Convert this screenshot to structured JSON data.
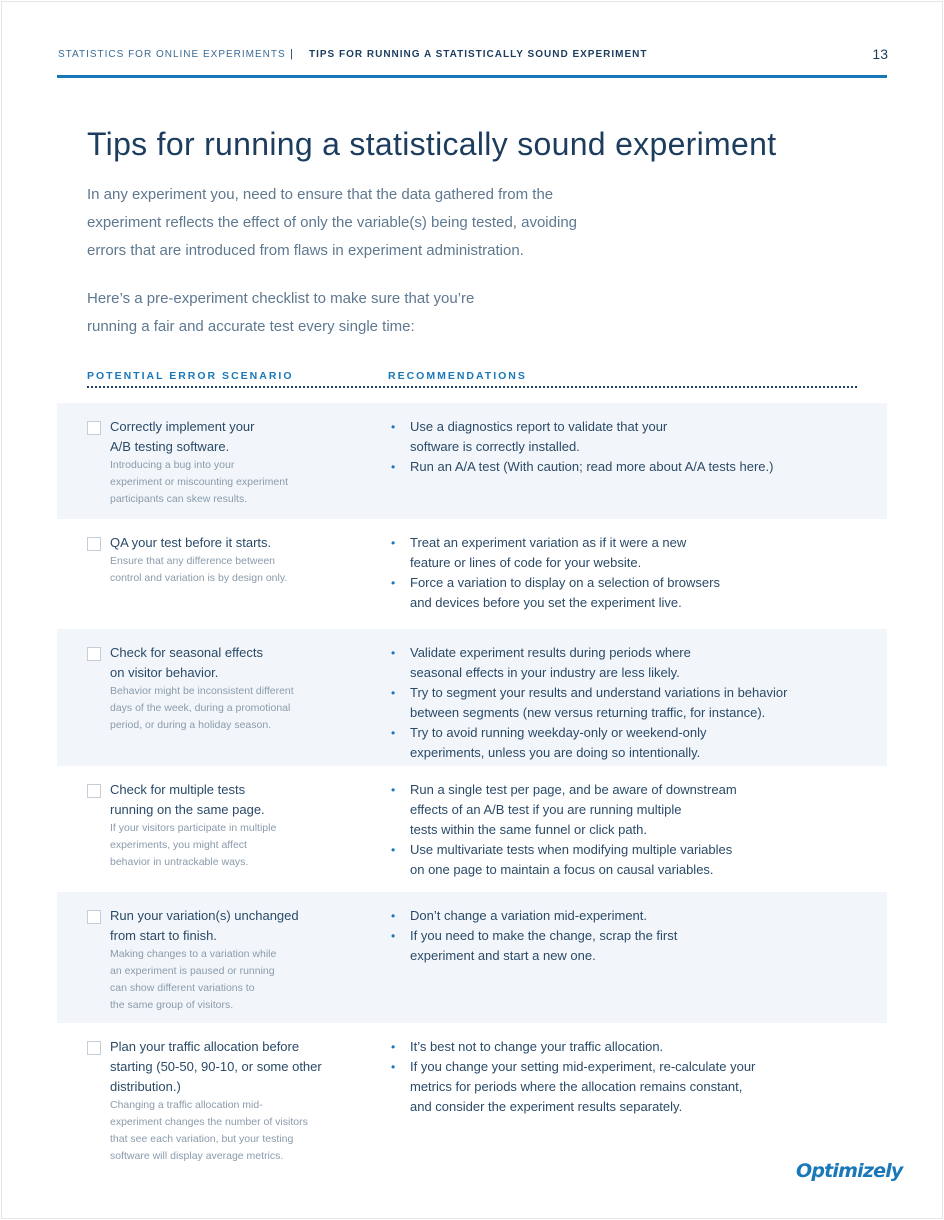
{
  "header": {
    "running_title": "STATISTICS FOR ONLINE EXPERIMENTS",
    "separator": "|",
    "section_title": "TIPS FOR RUNNING A STATISTICALLY SOUND EXPERIMENT",
    "page_number": "13"
  },
  "main": {
    "title": "Tips for running a statistically sound experiment",
    "intro_lines": [
      "In any experiment you, need to ensure that the data gathered from the",
      "experiment reflects the effect of only the variable(s) being tested, avoiding",
      "errors that are introduced from flaws in experiment administration."
    ],
    "checklist_intro_lines": [
      "Here’s a pre-experiment checklist to make sure that you’re",
      "running a fair and accurate test every single time:"
    ],
    "col_scenario": "POTENTIAL ERROR SCENARIO",
    "col_recommendations": "RECOMMENDATIONS"
  },
  "rows": [
    {
      "scenario_lines": [
        "Correctly implement your",
        "A/B testing software."
      ],
      "desc_lines": [
        "Introducing a bug into your",
        "experiment or miscounting experiment",
        "participants can skew results."
      ],
      "recs": [
        [
          "Use a diagnostics report to validate that your",
          "software is correctly installed."
        ],
        [
          "Run an A/A test (With caution; read more about A/A tests here.)"
        ]
      ]
    },
    {
      "scenario_lines": [
        "QA your test before it starts."
      ],
      "desc_lines": [
        "Ensure that any difference between",
        "control and variation is by design only."
      ],
      "recs": [
        [
          "Treat an experiment variation as if it were a new",
          "feature or lines of code for your website."
        ],
        [
          "Force a variation to display on a selection of browsers",
          "and devices before you set the experiment live."
        ]
      ]
    },
    {
      "scenario_lines": [
        "Check for seasonal effects",
        "on visitor behavior."
      ],
      "desc_lines": [
        "Behavior might be inconsistent different",
        "days of the week, during a promotional",
        "period, or during a holiday season."
      ],
      "recs": [
        [
          "Validate experiment results during periods where",
          "seasonal effects in your industry are less likely."
        ],
        [
          "Try to segment your results and understand variations in behavior",
          "between segments (new versus returning traffic, for instance)."
        ],
        [
          "Try to avoid running weekday-only or weekend-only",
          "experiments, unless you are doing so intentionally."
        ]
      ]
    },
    {
      "scenario_lines": [
        "Check for multiple tests",
        "running on the same page."
      ],
      "desc_lines": [
        "If your visitors participate in multiple",
        "experiments, you might affect",
        "behavior in untrackable ways."
      ],
      "recs": [
        [
          "Run a single test per page, and be aware of downstream",
          "effects of an A/B test if you are running multiple",
          "tests within the same funnel or click path."
        ],
        [
          "Use multivariate tests when modifying multiple variables",
          "on one page to maintain a focus on causal variables."
        ]
      ]
    },
    {
      "scenario_lines": [
        "Run your variation(s) unchanged",
        "from start to finish."
      ],
      "desc_lines": [
        "Making changes to a variation while",
        "an experiment is paused or running",
        "can show different variations to",
        "the same group of visitors."
      ],
      "recs": [
        [
          "Don’t change a variation mid-experiment."
        ],
        [
          "If you need to make the change, scrap the first",
          "experiment and start a new one."
        ]
      ]
    },
    {
      "scenario_lines": [
        "Plan your traffic allocation before",
        "starting (50-50, 90-10, or some other",
        "distribution.)"
      ],
      "desc_lines": [
        "Changing a traffic allocation mid-",
        "experiment changes the number of visitors",
        "that see each variation, but your testing",
        "software will display average metrics."
      ],
      "recs": [
        [
          "It’s best not to change your traffic allocation."
        ],
        [
          "If you change your setting mid-experiment, re-calculate your",
          "metrics for periods where the allocation remains constant,",
          "and consider the experiment results separately."
        ]
      ]
    }
  ],
  "footer": {
    "logo_text": "Optimizely"
  },
  "colors": {
    "accent": "#1a77b9",
    "heading": "#1c3d5e",
    "row_shade": "#f2f6fa"
  }
}
